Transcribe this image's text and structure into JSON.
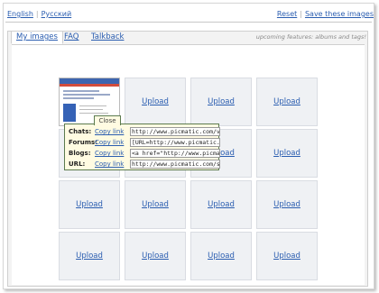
{
  "header": {
    "languages": [
      "English",
      "Русский"
    ],
    "actions": [
      "Reset",
      "Save these images"
    ]
  },
  "tabs": [
    {
      "label": "My images",
      "active": true
    },
    {
      "label": "FAQ",
      "active": false
    },
    {
      "label": "Talkback",
      "active": false
    }
  ],
  "upcoming_note": "upcoming features: albums and tags!",
  "grid": {
    "upload_label": "Upload",
    "rows": 4,
    "cols": 4,
    "first_cell_has_image": true
  },
  "popup": {
    "close_label": "Close",
    "rows": [
      {
        "label": "Chats:",
        "link": "Copy link",
        "value": "http://www.picmatic.com/view"
      },
      {
        "label": "Forums:",
        "link": "Copy link",
        "value": "[URL=http://www.picmatic.com"
      },
      {
        "label": "Blogs:",
        "link": "Copy link",
        "value": "<a href=\"http://www.picmatic"
      },
      {
        "label": "URL:",
        "link": "Copy link",
        "value": "http://www.picmatic.com/shor"
      }
    ]
  },
  "colors": {
    "link": "#2a5db0",
    "popup_bg": "#fffbe2",
    "popup_border": "#5c7b4e",
    "cell_bg": "#eff1f4"
  }
}
